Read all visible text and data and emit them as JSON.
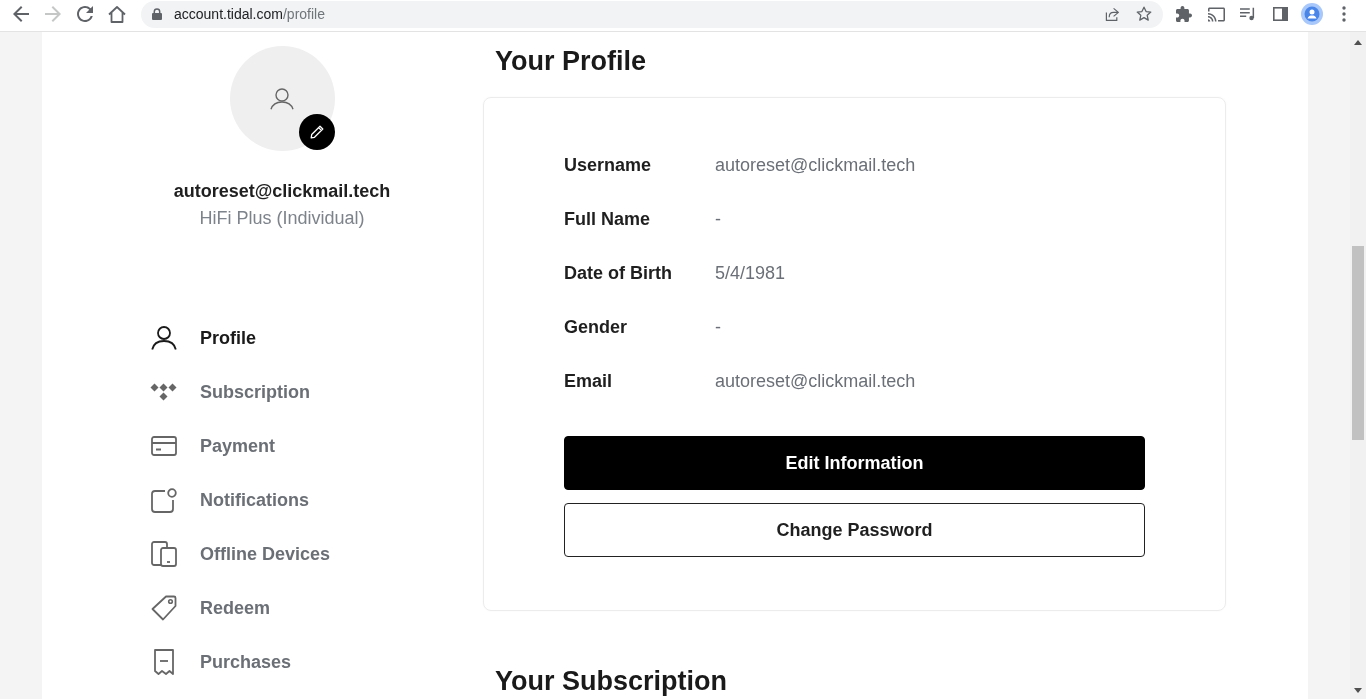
{
  "browser": {
    "nav_buttons": [
      {
        "kind": "back",
        "disabled": false
      },
      {
        "kind": "forward",
        "disabled": true
      },
      {
        "kind": "reload",
        "disabled": false
      },
      {
        "kind": "home",
        "disabled": false
      }
    ],
    "url": {
      "host": "account.tidal.com",
      "path": "/profile"
    }
  },
  "account": {
    "email": "autoreset@clickmail.tech",
    "plan": "HiFi Plus (Individual)"
  },
  "sidebar": {
    "items": [
      {
        "label": "Profile",
        "selected": true
      },
      {
        "label": "Subscription",
        "selected": false
      },
      {
        "label": "Payment",
        "selected": false
      },
      {
        "label": "Notifications",
        "selected": false
      },
      {
        "label": "Offline Devices",
        "selected": false
      },
      {
        "label": "Redeem",
        "selected": false
      },
      {
        "label": "Purchases",
        "selected": false
      }
    ]
  },
  "profile": {
    "title": "Your Profile",
    "fields": [
      {
        "label": "Username",
        "value": "autoreset@clickmail.tech"
      },
      {
        "label": "Full Name",
        "value": "-"
      },
      {
        "label": "Date of Birth",
        "value": "5/4/1981"
      },
      {
        "label": "Gender",
        "value": "-"
      },
      {
        "label": "Email",
        "value": "autoreset@clickmail.tech"
      }
    ],
    "buttons": [
      {
        "label": "Edit Information",
        "kind": "primary"
      },
      {
        "label": "Change Password",
        "kind": "secondary"
      }
    ]
  },
  "subscription": {
    "title": "Your Subscription"
  }
}
